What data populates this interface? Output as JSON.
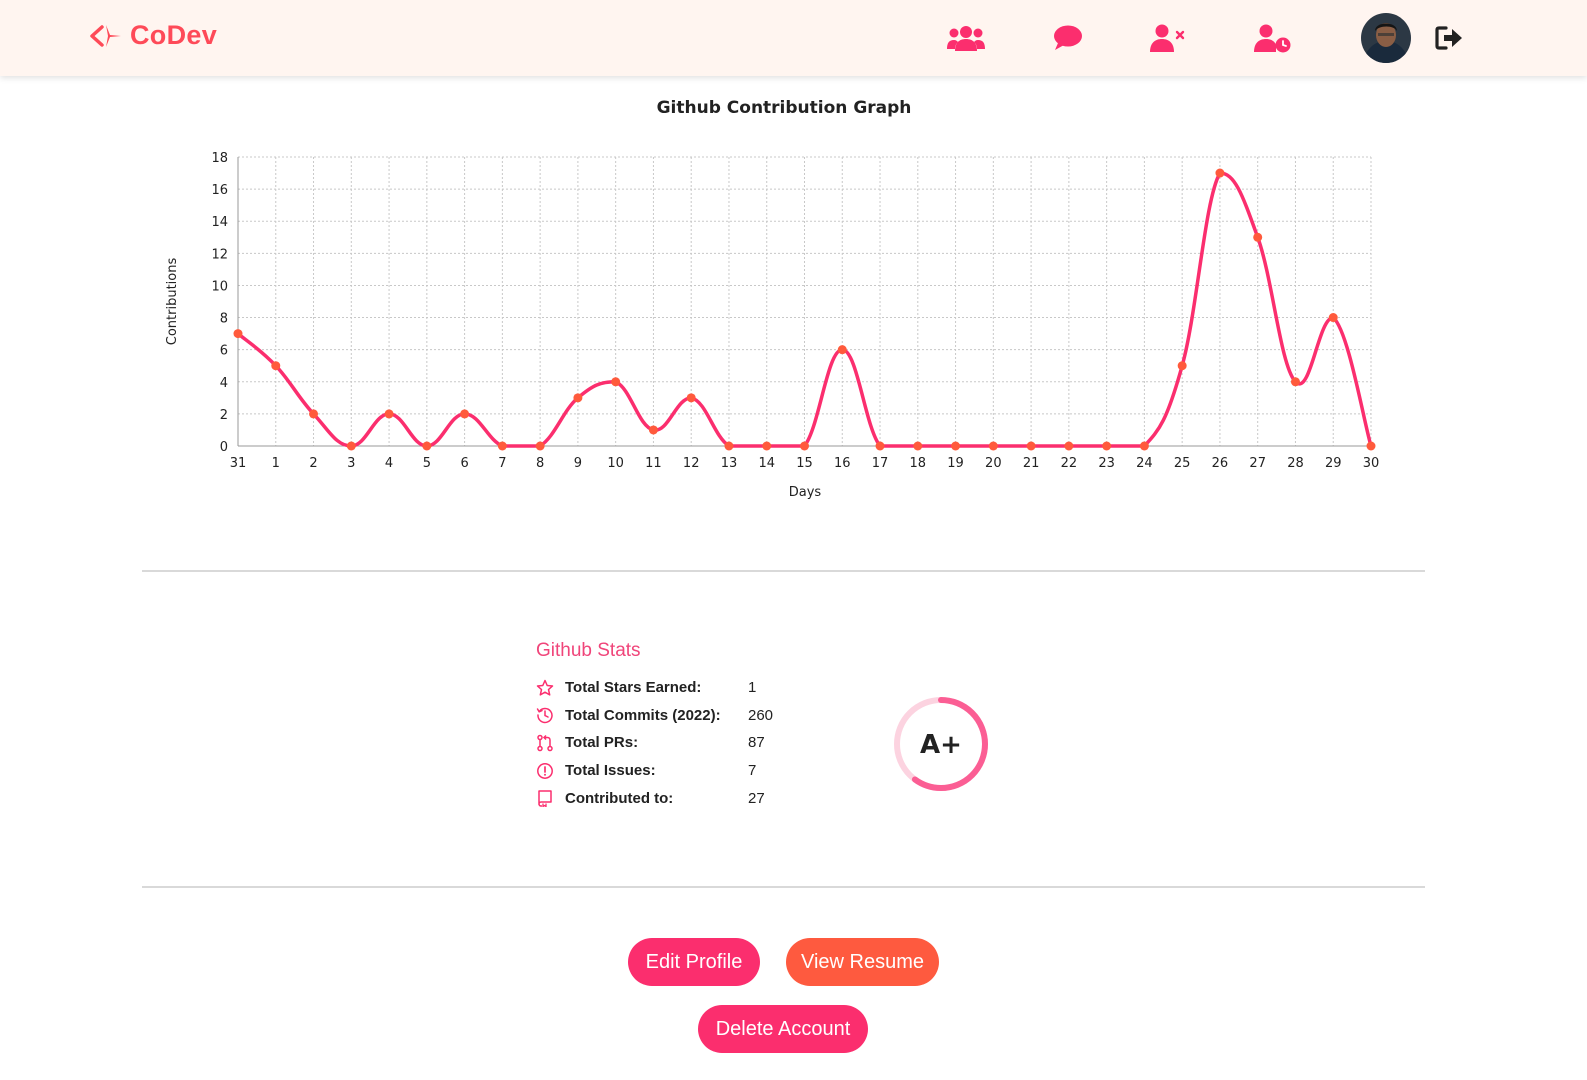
{
  "nav": {
    "brand": "CoDev",
    "brand_color": "#fe4a58",
    "icons": [
      "users-icon",
      "chat-icon",
      "user-remove-icon",
      "user-pending-icon",
      "avatar",
      "logout-icon"
    ]
  },
  "chart_data": {
    "type": "line",
    "title": "Github Contribution Graph",
    "xlabel": "Days",
    "ylabel": "Contributions",
    "categories": [
      "31",
      "1",
      "2",
      "3",
      "4",
      "5",
      "6",
      "7",
      "8",
      "9",
      "10",
      "11",
      "12",
      "13",
      "14",
      "15",
      "16",
      "17",
      "18",
      "19",
      "20",
      "21",
      "22",
      "23",
      "24",
      "25",
      "26",
      "27",
      "28",
      "29",
      "30"
    ],
    "values": [
      7,
      5,
      2,
      0,
      2,
      0,
      2,
      0,
      0,
      3,
      4,
      1,
      3,
      0,
      0,
      0,
      6,
      0,
      0,
      0,
      0,
      0,
      0,
      0,
      0,
      5,
      17,
      13,
      4,
      8,
      0
    ],
    "ylim": [
      0,
      18
    ],
    "yticks": [
      0,
      2,
      4,
      6,
      8,
      10,
      12,
      14,
      16,
      18
    ],
    "grid": true,
    "line_color": "#fb2e6e",
    "point_color": "#ff5a3c"
  },
  "stats": {
    "title": "Github Stats",
    "rows": [
      {
        "icon": "star-icon",
        "label": "Total Stars Earned:",
        "value": "1"
      },
      {
        "icon": "history-icon",
        "label": "Total Commits (2022):",
        "value": "260"
      },
      {
        "icon": "pull-request-icon",
        "label": "Total PRs:",
        "value": "87"
      },
      {
        "icon": "issue-icon",
        "label": "Total Issues:",
        "value": "7"
      },
      {
        "icon": "repo-icon",
        "label": "Contributed to:",
        "value": "27"
      }
    ],
    "grade": "A+",
    "grade_progress": 0.6
  },
  "actions": {
    "edit_profile": "Edit Profile",
    "view_resume": "View Resume",
    "delete_account": "Delete Account"
  },
  "colors": {
    "accent": "#fb2e6e",
    "orange": "#fe5a3f",
    "nav_bg": "#fff5f0"
  }
}
